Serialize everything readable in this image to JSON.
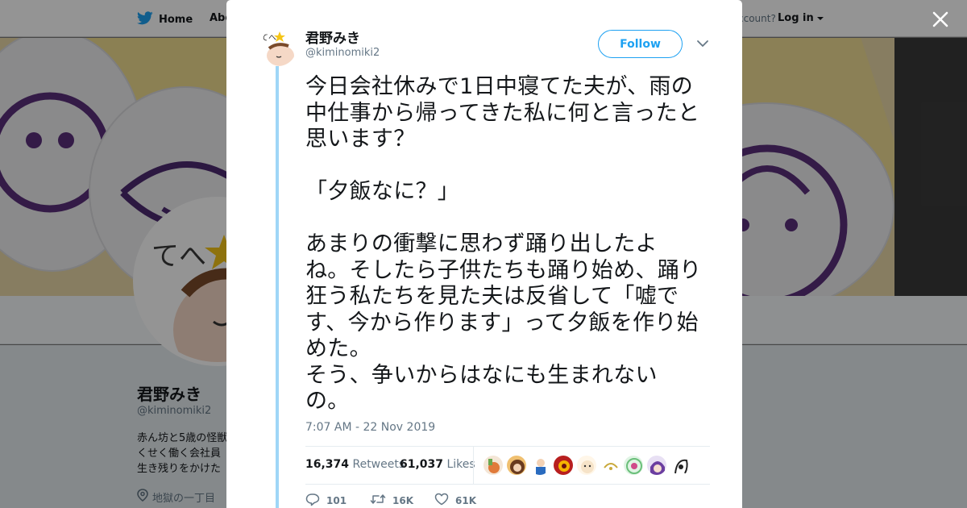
{
  "nav": {
    "home_label": "Home",
    "about_label": "Abo",
    "account_text": "ccount?",
    "login_label": "Log in"
  },
  "profile": {
    "name": "君野みき",
    "handle": "@kiminomiki2",
    "bio_lines": [
      "赤ん坊と5歳の怪獣",
      "くせく働く会社員",
      "生き残りをかけた"
    ],
    "location": "地獄の一丁目"
  },
  "tweet": {
    "author_name": "君野みき",
    "author_handle": "@kiminomiki2",
    "follow_label": "Follow",
    "text": "今日会社休みで1日中寝てた夫が、雨の\n中仕事から帰ってきた私に何と言ったと\n思います？\n\n「夕飯なに？」\n\nあまりの衝撃に思わず踊り出したよ\nね。そしたら子供たちも踊り始め、踊り\n狂う私たちを見た夫は反省して「嘘で\nす、今から作ります」って夕飯を作り始\nめた。\nそう、争いからはなにも生まれない\nの。",
    "timestamp": "7:07 AM - 22 Nov 2019",
    "retweets_count": "16,374",
    "retweets_label": "Retweets",
    "likes_count": "61,037",
    "likes_label": "Likes",
    "actions": {
      "reply_count": "101",
      "retweet_count": "16K",
      "like_count": "61K"
    }
  },
  "colors": {
    "accent": "#1da1f2",
    "thread_line": "#9fd6f7",
    "text_primary": "#14171a",
    "text_secondary": "#657786"
  },
  "icons": [
    "twitter-bird-icon",
    "caret-down-icon",
    "close-icon",
    "location-pin-icon",
    "reply-icon",
    "retweet-icon",
    "heart-icon",
    "chevron-down-icon"
  ]
}
